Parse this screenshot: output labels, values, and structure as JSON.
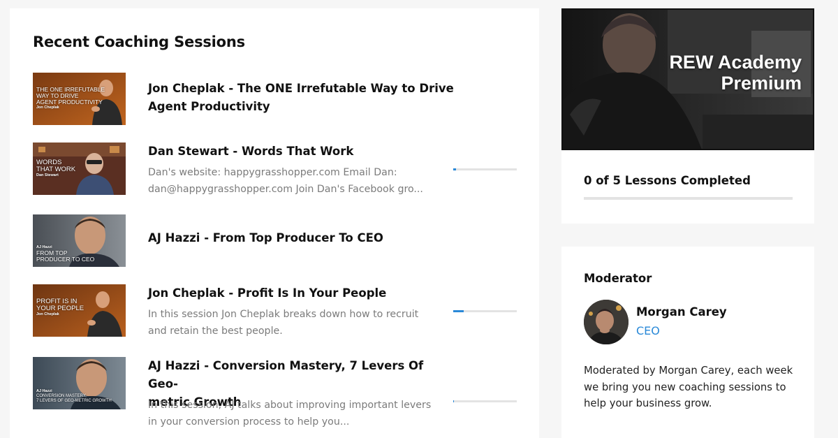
{
  "recent": {
    "title": "Recent Coaching Sessions",
    "sessions": [
      {
        "title_lines": [
          "Jon Cheplak - The ONE Irrefutable Way to Drive",
          "Agent Productivity"
        ],
        "description_lines": [],
        "progress": null,
        "thumb_caption": [
          "THE ONE IRREFUTABLE",
          "WAY TO DRIVE",
          "AGENT PRODUCTIVITY"
        ],
        "thumb_subcaption": "Jon Cheplak"
      },
      {
        "title_lines": [
          "Dan Stewart - Words That Work"
        ],
        "description_lines": [
          "Dan's website: happygrasshopper.com Email Dan:",
          "dan@happygrasshopper.com Join Dan's Facebook gro..."
        ],
        "progress": 0.04,
        "thumb_caption": [
          "WORDS",
          "THAT WORK"
        ],
        "thumb_subcaption": "Dan Stewart"
      },
      {
        "title_lines": [
          "AJ Hazzi - From Top Producer To CEO"
        ],
        "description_lines": [],
        "progress": null,
        "thumb_caption": [
          "FROM TOP",
          "PRODUCER TO CEO"
        ],
        "thumb_subcaption": "AJ Hazzi"
      },
      {
        "title_lines": [
          "Jon Cheplak - Profit Is In Your People"
        ],
        "description_lines": [
          "In this session Jon Cheplak breaks down how to recruit",
          "and retain the best people."
        ],
        "progress": 0.16,
        "thumb_caption": [
          "PROFIT IS IN",
          "YOUR PEOPLE"
        ],
        "thumb_subcaption": "Jon Cheplak"
      },
      {
        "title_lines": [
          "AJ Hazzi - Conversion Mastery, 7 Levers Of Geo-",
          "metric Growth"
        ],
        "description_lines": [
          "In this session, AJ talks about improving important levers",
          "in your conversion process to help you..."
        ],
        "progress": 0.01,
        "thumb_caption": [
          "CONVERSION MASTERY,",
          "7 LEVERS OF GEO-METRIC GROWTH"
        ],
        "thumb_subcaption": "AJ Hazzi"
      }
    ]
  },
  "academy": {
    "hero_title_lines": [
      "REW Academy",
      "Premium"
    ],
    "lessons_text": "0 of 5 Lessons Completed",
    "progress": 0
  },
  "moderator": {
    "heading": "Moderator",
    "name": "Morgan Carey",
    "role": "CEO",
    "description": "Moderated by Morgan Carey, each week we bring you new coaching sessions to help your business grow."
  },
  "colors": {
    "accent": "#2a89d8",
    "page_bg": "#f6f6f6",
    "card_bg": "#ffffff",
    "muted_text": "#7b7b7b"
  }
}
